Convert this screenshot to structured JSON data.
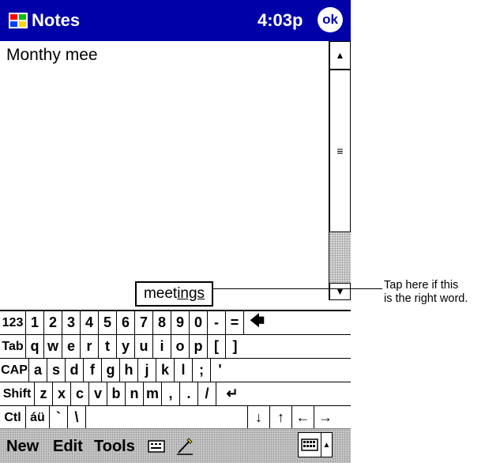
{
  "titlebar": {
    "app_name": "Notes",
    "time": "4:03p",
    "ok_label": "ok"
  },
  "note": {
    "text": "Monthy mee"
  },
  "scrollbar": {
    "up": "▲",
    "thumb": "≡",
    "down": "▼"
  },
  "suggestion": {
    "prefix": "meet",
    "suffix": "ings"
  },
  "annotation": {
    "line1": "Tap here if this",
    "line2": "is the right word."
  },
  "keyboard": {
    "row1": [
      "123",
      "1",
      "2",
      "3",
      "4",
      "5",
      "6",
      "7",
      "8",
      "9",
      "0",
      "-",
      "=",
      "🡄"
    ],
    "row2": [
      "Tab",
      "q",
      "w",
      "e",
      "r",
      "t",
      "y",
      "u",
      "i",
      "o",
      "p",
      "[",
      "]"
    ],
    "row3": [
      "CAP",
      "a",
      "s",
      "d",
      "f",
      "g",
      "h",
      "j",
      "k",
      "l",
      ";",
      "'"
    ],
    "row4": [
      "Shift",
      "z",
      "x",
      "c",
      "v",
      "b",
      "n",
      "m",
      ",",
      ".",
      "/",
      "↵"
    ],
    "row5": [
      "Ctl",
      "áü",
      "`",
      "\\",
      "",
      "↓",
      "↑",
      "←",
      "→"
    ]
  },
  "menubar": {
    "new": "New",
    "edit": "Edit",
    "tools": "Tools",
    "kb_arrow": "▲"
  },
  "colors": {
    "titlebar": "#0000a8",
    "menubar": "#c8c8c8"
  }
}
